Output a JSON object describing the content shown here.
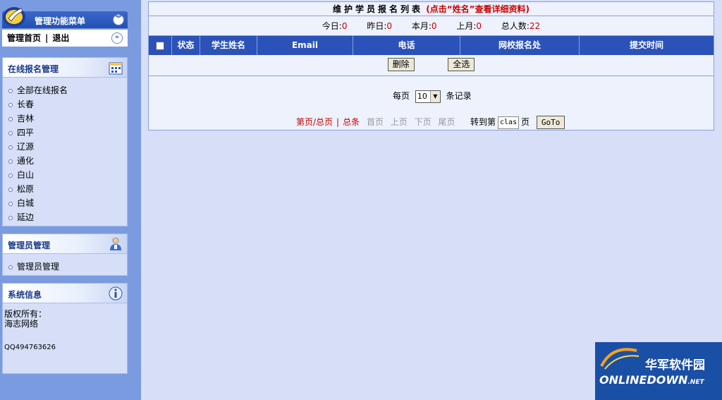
{
  "sidebar": {
    "menu_title": "管理功能菜单",
    "nav_links": {
      "home": "管理首页",
      "separator": "|",
      "logout": "退出"
    },
    "online_panel": {
      "title": "在线报名管理",
      "items": [
        "全部在线报名",
        "长春",
        "吉林",
        "四平",
        "辽源",
        "通化",
        "白山",
        "松原",
        "白城",
        "延边"
      ]
    },
    "admin_panel": {
      "title": "管理员管理",
      "items": [
        "管理员管理"
      ]
    },
    "info_panel": {
      "title": "系统信息",
      "copyright_label": "版权所有：",
      "owner": "海志网络",
      "qq": "QQ494763626"
    }
  },
  "main": {
    "title": "维护学员报名列表",
    "title_hint": "(点击“姓名”查看详细资料)",
    "stats": [
      {
        "label": "今日:",
        "value": "0"
      },
      {
        "label": "昨日:",
        "value": "0"
      },
      {
        "label": "本月:",
        "value": "0"
      },
      {
        "label": "上月:",
        "value": "0"
      },
      {
        "label": "总人数:",
        "value": "22"
      }
    ],
    "columns": [
      "状态",
      "学生姓名",
      "Email",
      "电话",
      "网校报名处",
      "提交时间"
    ],
    "delete_label": "删除",
    "select_all_label": "全选",
    "per_page_label": "每页",
    "per_page_value": "10",
    "records_label": "条记录",
    "pager": {
      "page_total": "第页/总页",
      "separator": "|",
      "total_items": "总条",
      "first": "首页",
      "prev": "上页",
      "next": "下页",
      "last": "尾页",
      "goto_label": "转到第",
      "goto_value": "clas",
      "page_unit": "页",
      "goto_button": "GoTo"
    }
  },
  "watermark": {
    "cn": "华军软件园",
    "en": "ONLINEDOWN",
    "en_suffix": ".NET"
  },
  "colors": {
    "sidebar_bg": "#7b9be0",
    "header_blue": "#2b52b8",
    "accent_red": "#cc0000",
    "page_bg": "#d6dff7"
  }
}
